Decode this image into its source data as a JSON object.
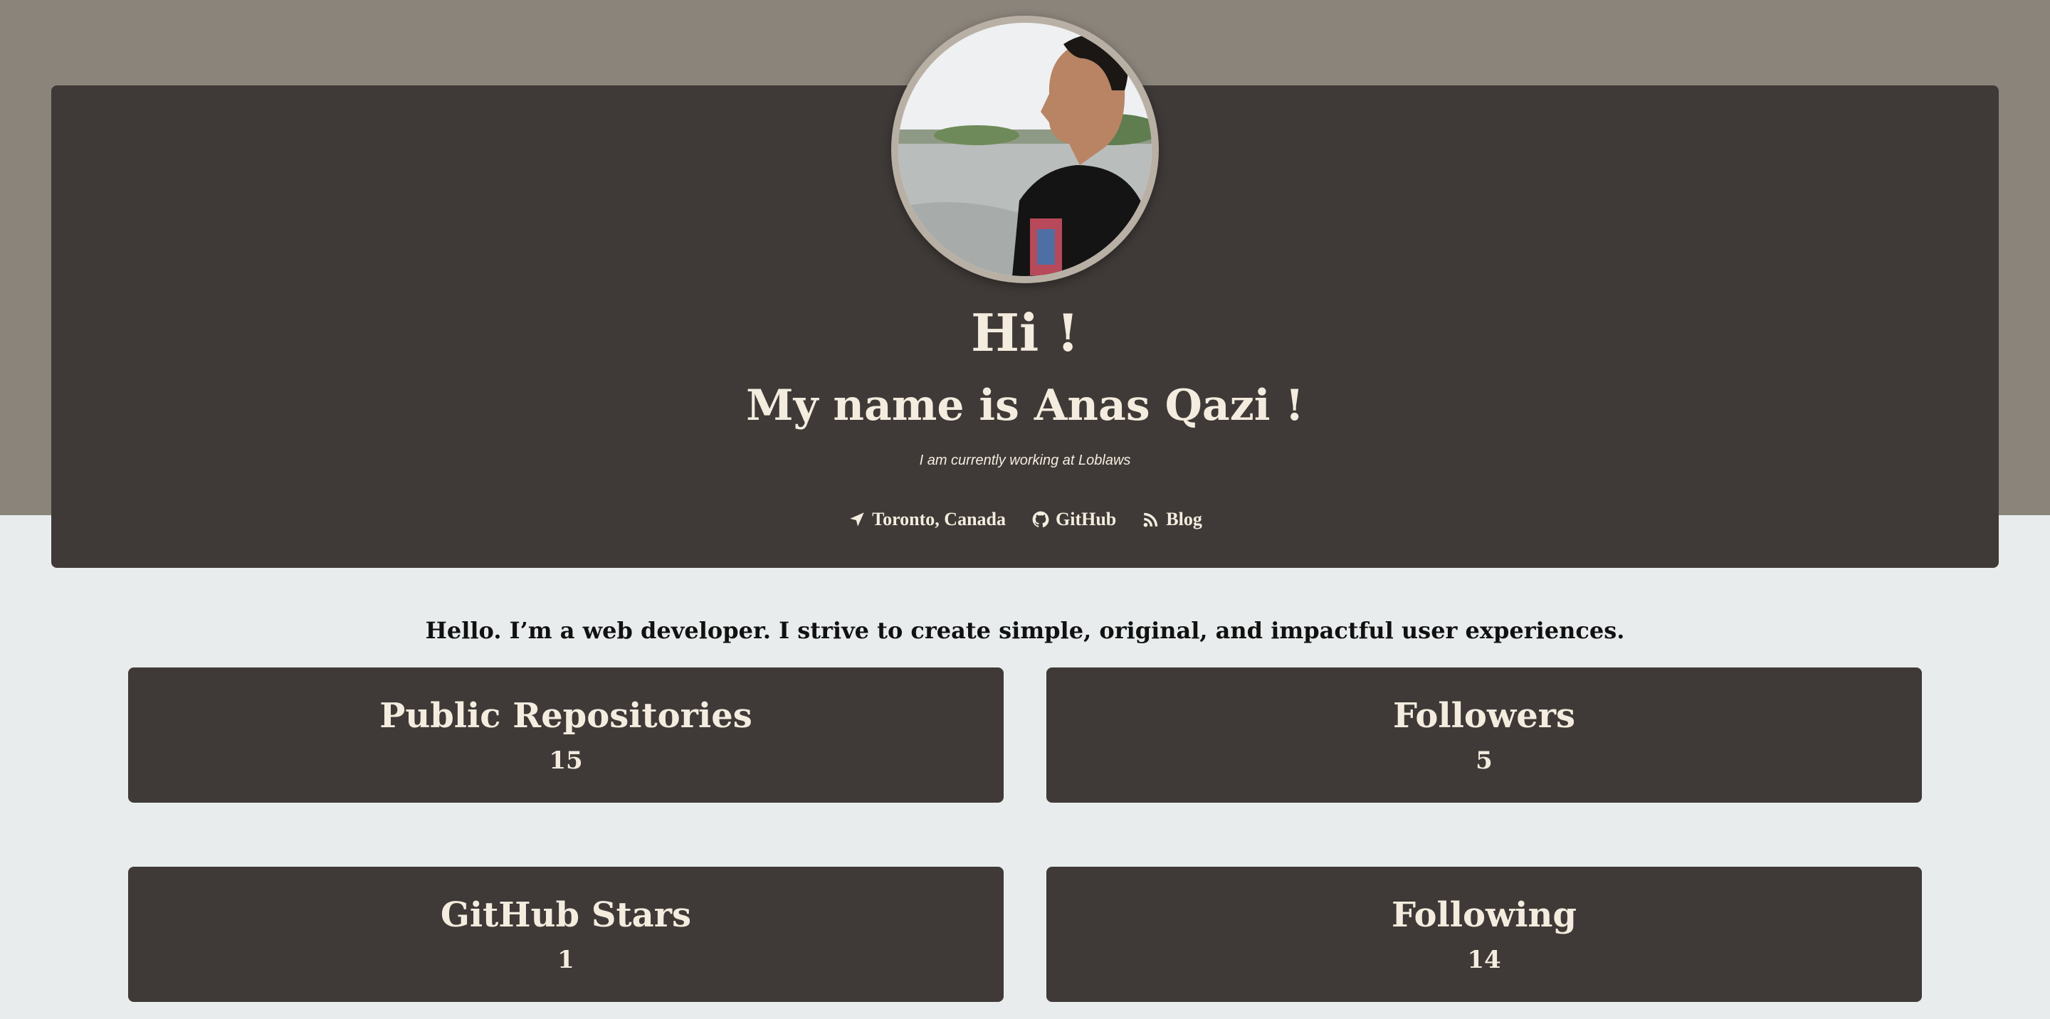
{
  "colors": {
    "band": "#8b847b",
    "panel": "#3f3a37",
    "text_light": "#f4ecdf",
    "page_bg": "#e8ecec"
  },
  "hero": {
    "greeting": "Hi !",
    "name_line": "My name is Anas Qazi !",
    "tagline": "I am currently working at Loblaws",
    "links": [
      {
        "icon": "location-arrow-icon",
        "label": "Toronto, Canada"
      },
      {
        "icon": "github-icon",
        "label": "GitHub"
      },
      {
        "icon": "rss-icon",
        "label": "Blog"
      }
    ]
  },
  "intro": "Hello. I’m a web developer. I strive to create simple, original, and impactful user experiences.",
  "stats": [
    {
      "title": "Public Repositories",
      "value": "15"
    },
    {
      "title": "Followers",
      "value": "5"
    },
    {
      "title": "GitHub Stars",
      "value": "1"
    },
    {
      "title": "Following",
      "value": "14"
    }
  ]
}
